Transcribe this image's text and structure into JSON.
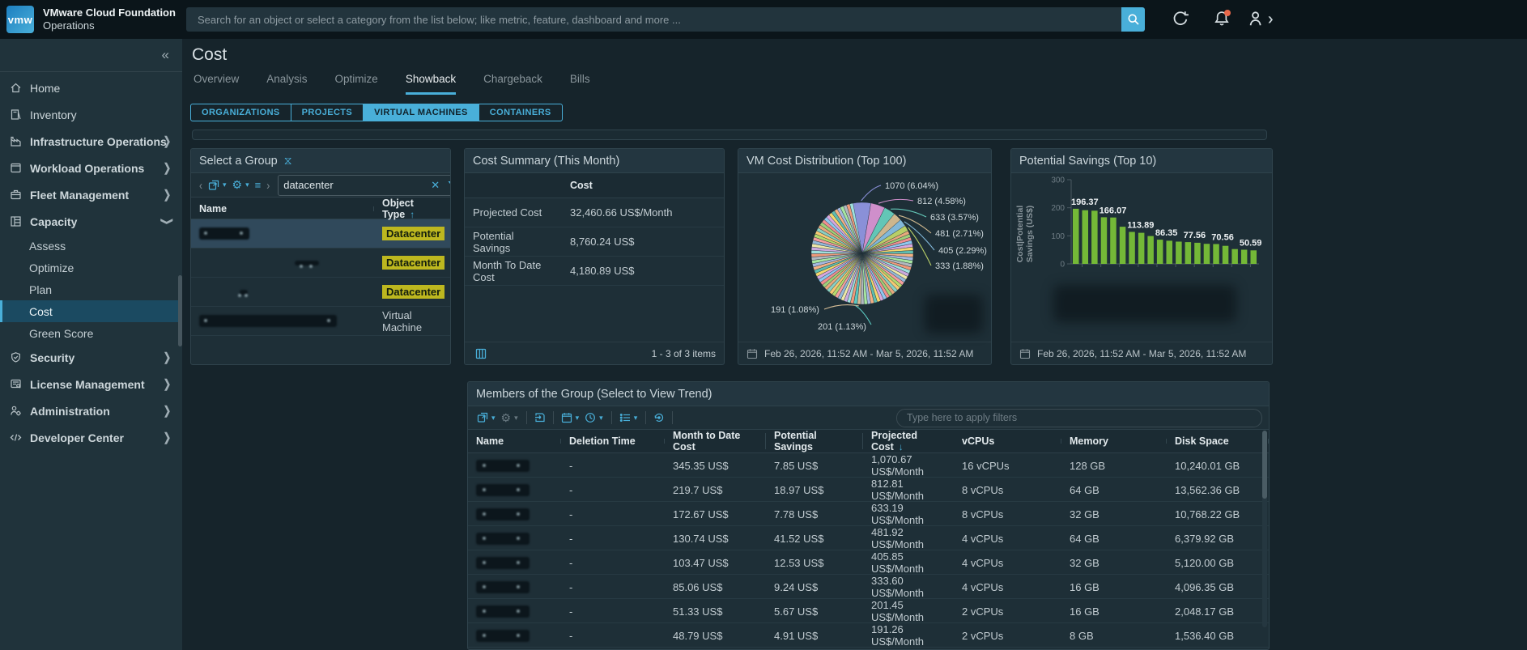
{
  "topbar": {
    "logo_text": "vmw",
    "brand_line1": "VMware Cloud Foundation",
    "brand_line2": "Operations",
    "search_placeholder": "Search for an object or select a category from the list below; like metric, feature, dashboard and more ...",
    "icons": {
      "search": "magnifier",
      "refresh": "circular-arrow",
      "notifications": "bell-with-red-dot",
      "user": "person-with-chevron"
    }
  },
  "sidebar": {
    "collapse_icon": "«",
    "items": [
      {
        "label": "Home",
        "icon": "home-icon",
        "type": "top"
      },
      {
        "label": "Inventory",
        "icon": "inventory-icon",
        "type": "top"
      },
      {
        "label": "Infrastructure Operations",
        "icon": "infrastructure-icon",
        "type": "section",
        "chevron": "right"
      },
      {
        "label": "Workload Operations",
        "icon": "workload-icon",
        "type": "section",
        "chevron": "right"
      },
      {
        "label": "Fleet Management",
        "icon": "fleet-icon",
        "type": "section",
        "chevron": "right"
      },
      {
        "label": "Capacity",
        "icon": "capacity-icon",
        "type": "section",
        "chevron": "down",
        "expanded": true
      },
      {
        "label": "Assess",
        "type": "child"
      },
      {
        "label": "Optimize",
        "type": "child"
      },
      {
        "label": "Plan",
        "type": "child"
      },
      {
        "label": "Cost",
        "type": "child",
        "selected": true
      },
      {
        "label": "Green Score",
        "type": "child"
      },
      {
        "label": "Security",
        "icon": "security-icon",
        "type": "section",
        "chevron": "right"
      },
      {
        "label": "License Management",
        "icon": "license-icon",
        "type": "section",
        "chevron": "right"
      },
      {
        "label": "Administration",
        "icon": "administration-icon",
        "type": "section",
        "chevron": "right"
      },
      {
        "label": "Developer Center",
        "icon": "developer-icon",
        "type": "section",
        "chevron": "right"
      }
    ]
  },
  "page": {
    "title": "Cost",
    "tabs": [
      {
        "label": "Overview"
      },
      {
        "label": "Analysis"
      },
      {
        "label": "Optimize"
      },
      {
        "label": "Showback",
        "active": true
      },
      {
        "label": "Chargeback"
      },
      {
        "label": "Bills"
      }
    ],
    "subtabs": [
      {
        "label": "ORGANIZATIONS"
      },
      {
        "label": "PROJECTS"
      },
      {
        "label": "VIRTUAL MACHINES",
        "active": true
      },
      {
        "label": "CONTAINERS"
      }
    ]
  },
  "select_group": {
    "title": "Select a Group",
    "search_value": "datacenter",
    "columns": [
      "Name",
      "Object Type"
    ],
    "sort_column": "Object Type",
    "sort_direction": "asc",
    "rows": [
      {
        "name_redacted": true,
        "object_type": "Datacenter",
        "badge": true,
        "selected": true
      },
      {
        "name_redacted": true,
        "object_type": "Datacenter",
        "badge": true
      },
      {
        "name_redacted": true,
        "object_type": "Datacenter",
        "badge": true
      },
      {
        "name_redacted": true,
        "object_type": "Virtual Machine",
        "badge": false
      }
    ]
  },
  "cost_summary": {
    "title": "Cost Summary (This Month)",
    "value_column": "Cost",
    "rows": [
      {
        "metric": "Projected Cost",
        "value": "32,460.66 US$/Month"
      },
      {
        "metric": "Potential Savings",
        "value": "8,760.24 US$"
      },
      {
        "metric": "Month To Date Cost",
        "value": "4,180.89 US$"
      }
    ],
    "footer_count": "1 - 3 of 3 items"
  },
  "chart_data": [
    {
      "type": "pie",
      "title": "VM Cost Distribution (Top 100)",
      "unit": "US$",
      "labeled_slices": [
        {
          "value": 1070,
          "pct": 6.04,
          "label": "1070 (6.04%)",
          "color": "#8a90d8",
          "side": "right"
        },
        {
          "value": 812,
          "pct": 4.58,
          "label": "812 (4.58%)",
          "color": "#cf8fcb",
          "side": "right"
        },
        {
          "value": 633,
          "pct": 3.57,
          "label": "633 (3.57%)",
          "color": "#63c6b6",
          "side": "right"
        },
        {
          "value": 481,
          "pct": 2.71,
          "label": "481 (2.71%)",
          "color": "#cdb68d",
          "side": "right"
        },
        {
          "value": 405,
          "pct": 2.29,
          "label": "405 (2.29%)",
          "color": "#82b8d9",
          "side": "right"
        },
        {
          "value": 333,
          "pct": 1.88,
          "label": "333 (1.88%)",
          "color": "#b8cf68",
          "side": "right"
        },
        {
          "value": 191,
          "pct": 1.08,
          "label": "191 (1.08%)",
          "color": "#d6bd96",
          "side": "left"
        },
        {
          "value": 201,
          "pct": 1.13,
          "label": "201 (1.13%)",
          "color": "#5bc8c0",
          "side": "left"
        }
      ],
      "other_slices_note": "remaining ~77% split across many thin slices (Top 100 VMs)",
      "footer_date_range": "Feb 26, 2026, 11:52 AM - Mar 5, 2026, 11:52 AM"
    },
    {
      "type": "bar",
      "title": "Potential Savings (Top 10)",
      "ylabel": "Cost|Potential Savings (US$)",
      "ylim": [
        0,
        300
      ],
      "yticks": [
        0,
        100,
        200,
        300
      ],
      "bar_color": "#74b837",
      "values": [
        196.37,
        191.2,
        189.5,
        166.07,
        165.3,
        132.4,
        113.89,
        110.8,
        99.1,
        86.35,
        82.4,
        79.2,
        77.56,
        75.3,
        71.6,
        70.56,
        64.2,
        52.8,
        50.59,
        48.2
      ],
      "bar_labels": {
        "0": "196.37",
        "3": "166.07",
        "6": "113.89",
        "9": "86.35",
        "12": "77.56",
        "15": "70.56",
        "18": "50.59"
      },
      "footer_date_range": "Feb 26, 2026, 11:52 AM - Mar 5, 2026, 11:52 AM"
    }
  ],
  "members": {
    "title": "Members of the Group (Select to View Trend)",
    "filter_placeholder": "Type here to apply filters",
    "columns": [
      "Name",
      "Deletion Time",
      "Month to Date Cost",
      "Potential Savings",
      "Projected Cost",
      "vCPUs",
      "Memory",
      "Disk Space"
    ],
    "sort_column": "Projected Cost",
    "sort_direction": "desc",
    "rows": [
      {
        "name_redacted": true,
        "deletion_time": "-",
        "mtd_cost": "345.35 US$",
        "savings": "7.85 US$",
        "projected": "1,070.67 US$/Month",
        "vcpus": "16 vCPUs",
        "memory": "128 GB",
        "disk": "10,240.01 GB"
      },
      {
        "name_redacted": true,
        "deletion_time": "-",
        "mtd_cost": "219.7 US$",
        "savings": "18.97 US$",
        "projected": "812.81 US$/Month",
        "vcpus": "8 vCPUs",
        "memory": "64 GB",
        "disk": "13,562.36 GB"
      },
      {
        "name_redacted": true,
        "deletion_time": "-",
        "mtd_cost": "172.67 US$",
        "savings": "7.78 US$",
        "projected": "633.19 US$/Month",
        "vcpus": "8 vCPUs",
        "memory": "32 GB",
        "disk": "10,768.22 GB"
      },
      {
        "name_redacted": true,
        "deletion_time": "-",
        "mtd_cost": "130.74 US$",
        "savings": "41.52 US$",
        "projected": "481.92 US$/Month",
        "vcpus": "4 vCPUs",
        "memory": "64 GB",
        "disk": "6,379.92 GB"
      },
      {
        "name_redacted": true,
        "deletion_time": "-",
        "mtd_cost": "103.47 US$",
        "savings": "12.53 US$",
        "projected": "405.85 US$/Month",
        "vcpus": "4 vCPUs",
        "memory": "32 GB",
        "disk": "5,120.00 GB"
      },
      {
        "name_redacted": true,
        "deletion_time": "-",
        "mtd_cost": "85.06 US$",
        "savings": "9.24 US$",
        "projected": "333.60 US$/Month",
        "vcpus": "4 vCPUs",
        "memory": "16 GB",
        "disk": "4,096.35 GB"
      },
      {
        "name_redacted": true,
        "deletion_time": "-",
        "mtd_cost": "51.33 US$",
        "savings": "5.67 US$",
        "projected": "201.45 US$/Month",
        "vcpus": "2 vCPUs",
        "memory": "16 GB",
        "disk": "2,048.17 GB"
      },
      {
        "name_redacted": true,
        "deletion_time": "-",
        "mtd_cost": "48.79 US$",
        "savings": "4.91 US$",
        "projected": "191.26 US$/Month",
        "vcpus": "2 vCPUs",
        "memory": "8 GB",
        "disk": "1,536.40 GB"
      }
    ]
  }
}
